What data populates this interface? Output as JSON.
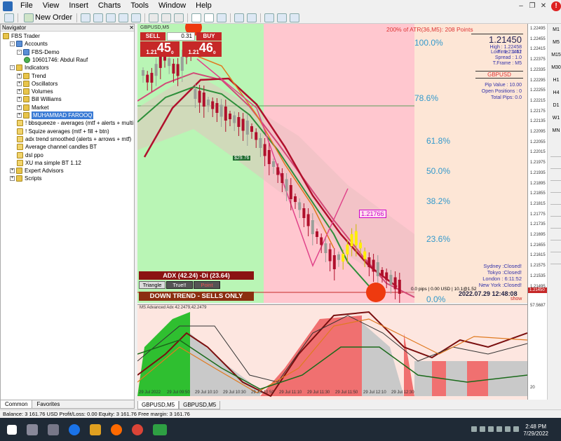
{
  "menu": [
    "File",
    "View",
    "Insert",
    "Charts",
    "Tools",
    "Window",
    "Help"
  ],
  "toolbar": {
    "new_order": "New Order"
  },
  "navigator": {
    "title": "Navigator",
    "items": [
      {
        "label": "FBS Trader",
        "level": 0,
        "icon": "folder-icon",
        "exp": ""
      },
      {
        "label": "Accounts",
        "level": 1,
        "icon": "accounts-icon",
        "exp": "-"
      },
      {
        "label": "FBS-Demo",
        "level": 2,
        "icon": "server-icon",
        "exp": "-"
      },
      {
        "label": "10601746: Abdul Rauf",
        "level": 3,
        "icon": "user-icon",
        "exp": ""
      },
      {
        "label": "Indicators",
        "level": 1,
        "icon": "indicators-icon",
        "exp": "-"
      },
      {
        "label": "Trend",
        "level": 2,
        "icon": "folder-icon",
        "exp": "+"
      },
      {
        "label": "Oscillators",
        "level": 2,
        "icon": "folder-icon",
        "exp": "+"
      },
      {
        "label": "Volumes",
        "level": 2,
        "icon": "folder-icon",
        "exp": "+"
      },
      {
        "label": "Bill Williams",
        "level": 2,
        "icon": "folder-icon",
        "exp": "+"
      },
      {
        "label": "Market",
        "level": 2,
        "icon": "folder-icon",
        "exp": "+"
      },
      {
        "label": "MUHAMMAD FAROOQ",
        "level": 2,
        "icon": "folder-icon",
        "exp": "+",
        "selected": true
      },
      {
        "label": "! bbsqueeze - averages (mtf + alerts + multi",
        "level": 2,
        "icon": "indicator-icon",
        "exp": ""
      },
      {
        "label": "! Squize averages (mtf + fill + btn)",
        "level": 2,
        "icon": "indicator-icon",
        "exp": ""
      },
      {
        "label": "adx trend smoothed (alerts + arrows + mtf)",
        "level": 2,
        "icon": "indicator-icon",
        "exp": ""
      },
      {
        "label": "Average channel candles BT",
        "level": 2,
        "icon": "indicator-icon",
        "exp": ""
      },
      {
        "label": "dsl ppo",
        "level": 2,
        "icon": "indicator-icon",
        "exp": ""
      },
      {
        "label": "XU ma simple BT 1.12",
        "level": 2,
        "icon": "indicator-icon",
        "exp": ""
      },
      {
        "label": "Expert Advisors",
        "level": 1,
        "icon": "experts-icon",
        "exp": "+"
      },
      {
        "label": "Scripts",
        "level": 1,
        "icon": "scripts-icon",
        "exp": "+"
      }
    ],
    "tabs": [
      "Common",
      "Favorites"
    ]
  },
  "chart": {
    "symbol_label": "GBPUSD,M5",
    "trade_panel": {
      "sell": "SELL",
      "buy": "BUY",
      "lot": "0.31",
      "sell_prefix": "1.21",
      "sell_big": "45",
      "sell_sup": "0",
      "buy_prefix": "1.21",
      "buy_big": "46",
      "buy_sup": "0"
    },
    "atr_text": "200% of ATR(36,M5): 208  Points",
    "price_big": "1.21450",
    "high": "High : 1.22458",
    "low": "Low : 1.21441",
    "time": "Time : 1:52",
    "spread": "Spread : 1.0",
    "tframe": "T.Frame : M5",
    "pair": "GBPUSD",
    "pip_value": "Pip Value : 10.00",
    "open_positions": "Open Positions : 0",
    "total_pips": "Total Pips: 0.0",
    "fib": [
      "100.0%",
      "78.6%",
      "61.8%",
      "50.0%",
      "38.2%",
      "23.6%",
      "0.0%"
    ],
    "marker_price": "1.21766",
    "marker_dollar": "$29.76",
    "sessions": [
      "Sydney :Closed!",
      "Tokyo :Closed!",
      "London : 6:11:52",
      "New York :Closed!"
    ],
    "pips_line": "0.0 pips | 0.00 USD | 10.1@1.52",
    "datetime": "2022.07.29 12:48:08",
    "adx": "ADX (42.24)  -Di (23.64)",
    "buttons": [
      "Triangle",
      "True!!",
      "Point"
    ],
    "trend": "DOWN TREND - SELLS ONLY",
    "show": "show"
  },
  "indicator": {
    "label": "MS Advanced Adx 42.2479,42.2479",
    "level_top": "57.5687",
    "level_bottom": "20",
    "time_labels": [
      "29 Jul 2022",
      "29 Jul 09:50",
      "29 Jul 10:10",
      "29 Jul 10:30",
      "29 Jul 10:50",
      "29 Jul 11:10",
      "29 Jul 11:30",
      "29 Jul 11:50",
      "29 Jul 12:10",
      "29 Jul 12:30"
    ]
  },
  "price_axis": [
    "1.22495",
    "1.22455",
    "1.22415",
    "1.22375",
    "1.22335",
    "1.22295",
    "1.22255",
    "1.22215",
    "1.22175",
    "1.22135",
    "1.22095",
    "1.22055",
    "1.22015",
    "1.21975",
    "1.21935",
    "1.21895",
    "1.21855",
    "1.21815",
    "1.21775",
    "1.21735",
    "1.21695",
    "1.21655",
    "1.21615",
    "1.21575",
    "1.21535",
    "1.21495"
  ],
  "current_tag": "1.21450",
  "timeframes": [
    "M1",
    "M5",
    "M15",
    "M30",
    "H1",
    "H4",
    "D1",
    "W1",
    "MN"
  ],
  "chart_tabs": [
    "GBPUSD,M5",
    "GBPUSD,M5"
  ],
  "status": "Balance: 3 161.76 USD  Profit/Loss: 0.00  Equity: 3 161.76  Free margin: 3 161.76",
  "clock": {
    "time": "2:48 PM",
    "date": "7/29/2022"
  }
}
